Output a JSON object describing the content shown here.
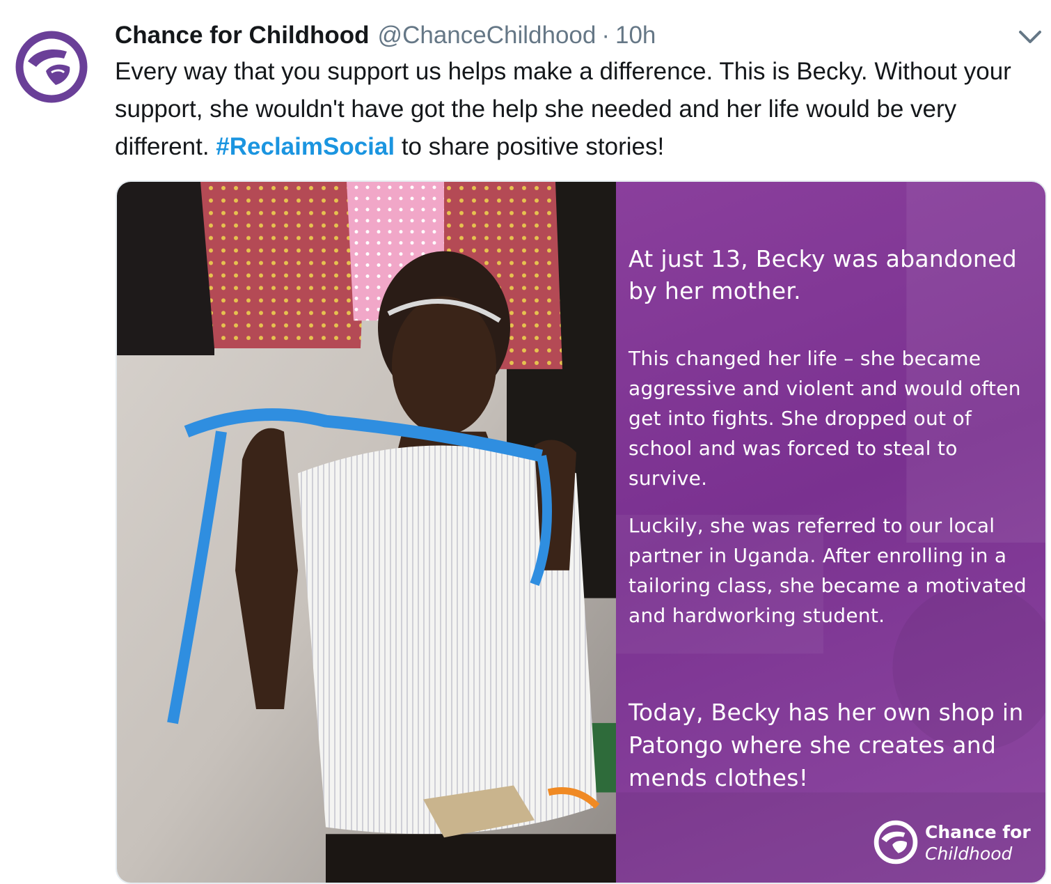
{
  "tweet": {
    "author_name": "Chance for Childhood",
    "handle": "@ChanceChildhood",
    "separator": "·",
    "time": "10h",
    "text_before": "Every way that you support us helps make a difference. This is Becky. Without your support, she wouldn't have got the help she needed and her life would be very different. ",
    "hashtag": "#ReclaimSocial",
    "text_after": " to share positive stories!"
  },
  "image_panel": {
    "p1": "At just 13, Becky was abandoned by her mother.",
    "p2": "This changed her life – she became aggressive and violent and would often get into fights. She dropped out of school and was forced to steal to survive.",
    "p3": "Luckily, she was referred to our local partner in Uganda. After enrolling in a tailoring class, she became a motivated and hardworking student.",
    "p4": "Today, Becky has her own shop in Patongo where she creates and mends clothes!",
    "logo_line1": "Chance for",
    "logo_line2": "Childhood"
  },
  "icons": {
    "avatar": "chance-for-childhood-logo",
    "menu": "chevron-down-icon"
  },
  "colors": {
    "hashtag": "#1b95e0",
    "brand_purple": "#7a3190"
  }
}
